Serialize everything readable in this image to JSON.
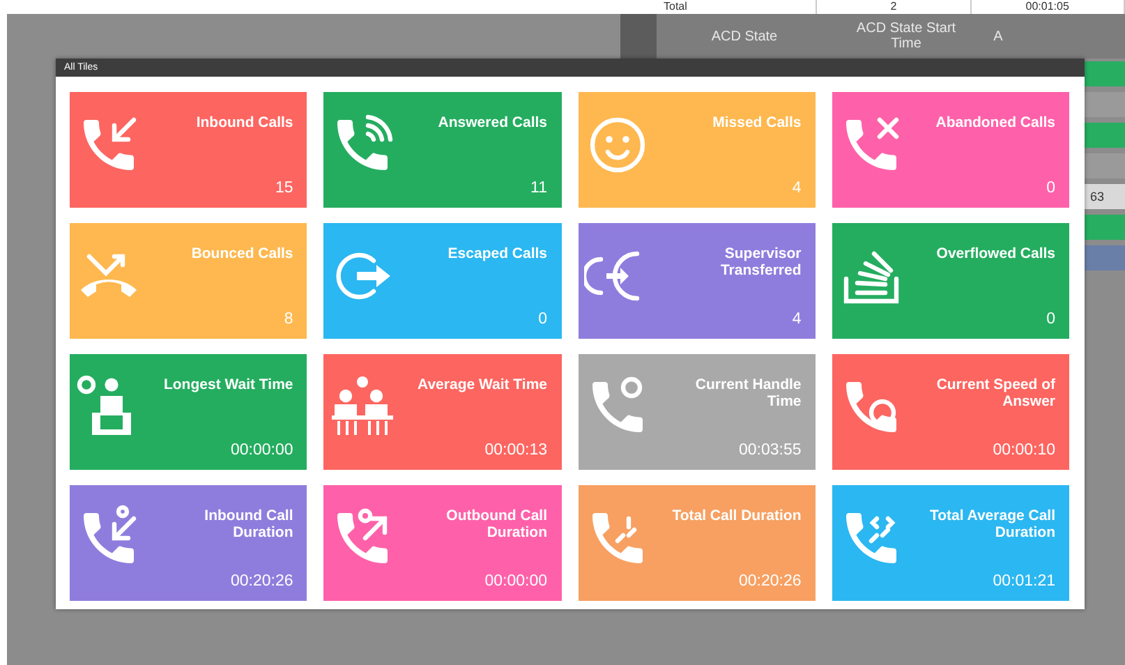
{
  "background_table": {
    "total_row": [
      "Total",
      "2",
      "00:01:05"
    ],
    "columns": [
      "ACD State",
      "ACD State Start Time",
      "A"
    ],
    "side_cells": [
      {
        "text": "",
        "color": "#27ae60"
      },
      {
        "text": "",
        "color": "#9a9a9a"
      },
      {
        "text": "",
        "color": "#27ae60"
      },
      {
        "text": "",
        "color": "#9a9a9a"
      },
      {
        "text": "63",
        "color": "#d9d9d9"
      },
      {
        "text": "",
        "color": "#27ae60"
      },
      {
        "text": "",
        "color": "#6a7fa8"
      }
    ]
  },
  "dialog": {
    "title": "All Tiles"
  },
  "tiles": [
    {
      "label": "Inbound Calls",
      "value": "15",
      "color": "#fd6560"
    },
    {
      "label": "Answered Calls",
      "value": "11",
      "color": "#24ad5f"
    },
    {
      "label": "Missed Calls",
      "value": "4",
      "color": "#feb84f"
    },
    {
      "label": "Abandoned Calls",
      "value": "0",
      "color": "#fe61a9"
    },
    {
      "label": "Bounced Calls",
      "value": "8",
      "color": "#feb84f"
    },
    {
      "label": "Escaped Calls",
      "value": "0",
      "color": "#2bb7f1"
    },
    {
      "label": "Supervisor Transferred",
      "value": "4",
      "color": "#8f7ddd"
    },
    {
      "label": "Overflowed Calls",
      "value": "0",
      "color": "#24ad5f"
    },
    {
      "label": "Longest Wait Time",
      "value": "00:00:00",
      "color": "#24ad5f"
    },
    {
      "label": "Average Wait Time",
      "value": "00:00:13",
      "color": "#fd6560"
    },
    {
      "label": "Current Handle Time",
      "value": "00:03:55",
      "color": "#a9a9a9"
    },
    {
      "label": "Current Speed of Answer",
      "value": "00:00:10",
      "color": "#fd6560"
    },
    {
      "label": "Inbound Call Duration",
      "value": "00:20:26",
      "color": "#8f7ddd"
    },
    {
      "label": "Outbound Call Duration",
      "value": "00:00:00",
      "color": "#fe61a9"
    },
    {
      "label": "Total Call Duration",
      "value": "00:20:26",
      "color": "#f7a062"
    },
    {
      "label": "Total Average Call Duration",
      "value": "00:01:21",
      "color": "#2bb7f1"
    }
  ]
}
